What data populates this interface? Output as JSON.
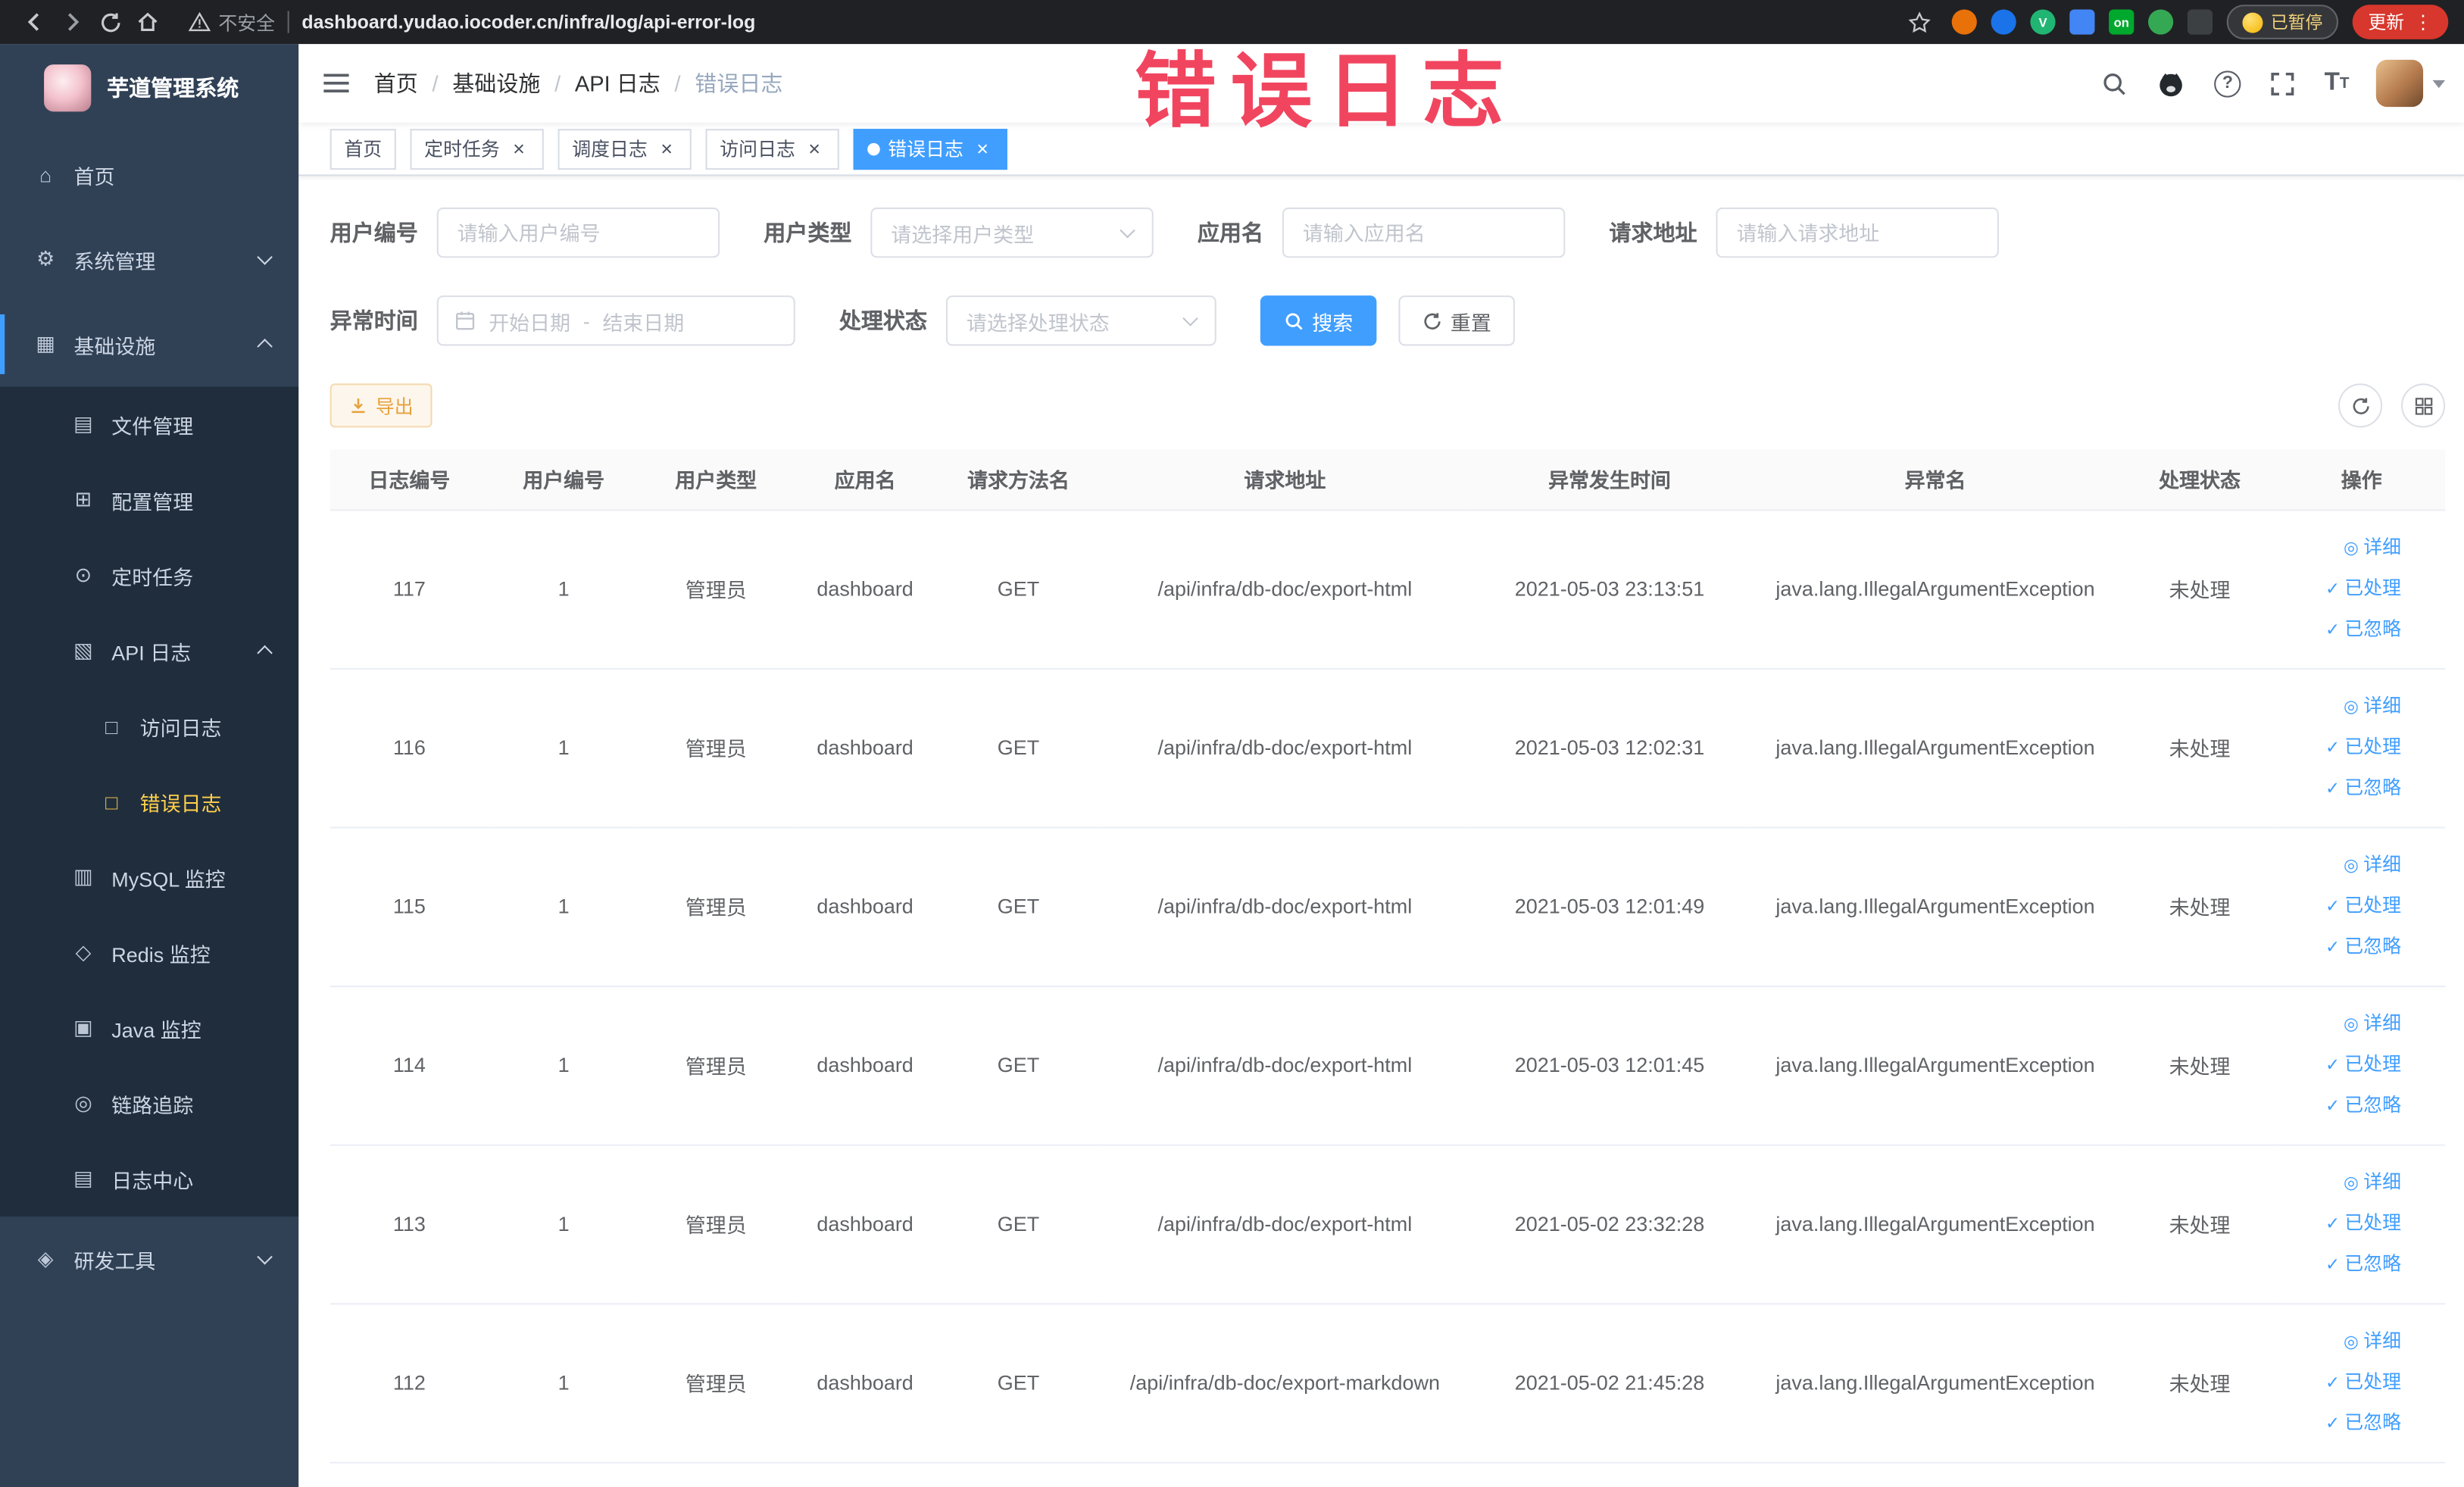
{
  "browser": {
    "security_label": "不安全",
    "url": "dashboard.yudao.iocoder.cn/infra/log/api-error-log",
    "paused_badge": "已暂停",
    "update_label": "更新",
    "extensions": [
      {
        "key": "orange",
        "icon": "extension-orange-icon",
        "color": "#e8710a",
        "shape": "circle",
        "text": ""
      },
      {
        "key": "blue-drop",
        "icon": "extension-blue-icon",
        "color": "#1a73e8",
        "shape": "circle",
        "text": ""
      },
      {
        "key": "green-v",
        "icon": "extension-green-v-icon",
        "color": "#21b573",
        "shape": "circle",
        "text": "V"
      },
      {
        "key": "blue-grid",
        "icon": "extension-grid-icon",
        "color": "#4285f4",
        "shape": "square",
        "text": ""
      },
      {
        "key": "on-badge",
        "icon": "extension-on-badge-icon",
        "color": "#00a82d",
        "shape": "square",
        "text": "on"
      },
      {
        "key": "green-leaf",
        "icon": "extension-leaf-icon",
        "color": "#34a853",
        "shape": "circle",
        "text": ""
      },
      {
        "key": "dark-pin",
        "icon": "extension-pin-icon",
        "color": "#3c4043",
        "shape": "square",
        "text": ""
      }
    ]
  },
  "watermark": "错误日志",
  "colors": {
    "accent": "#409eff",
    "sidebar_bg": "#304156",
    "active_menu_text": "#ffd04b",
    "watermark": "#f1455f",
    "warning": "#e6a23c"
  },
  "sidebar": {
    "logo_title": "芋道管理系统",
    "items": [
      {
        "key": "home",
        "label": "首页",
        "icon": "home-icon",
        "glyph": "⌂",
        "level": 1
      },
      {
        "key": "system",
        "label": "系统管理",
        "icon": "gear-icon",
        "glyph": "⚙",
        "level": 1,
        "arrow": "down"
      },
      {
        "key": "infra",
        "label": "基础设施",
        "icon": "infra-icon",
        "glyph": "▦",
        "level": 1,
        "arrow": "up",
        "open": true
      },
      {
        "key": "file",
        "label": "文件管理",
        "icon": "folder-icon",
        "glyph": "▤",
        "level": 2
      },
      {
        "key": "config",
        "label": "配置管理",
        "icon": "config-icon",
        "glyph": "⊞",
        "level": 2
      },
      {
        "key": "job",
        "label": "定时任务",
        "icon": "timer-icon",
        "glyph": "⊙",
        "level": 2
      },
      {
        "key": "api-log",
        "label": "API 日志",
        "icon": "api-log-icon",
        "glyph": "▧",
        "level": 2,
        "arrow": "up"
      },
      {
        "key": "access-log",
        "label": "访问日志",
        "icon": "access-log-icon",
        "glyph": "□",
        "level": 3
      },
      {
        "key": "error-log",
        "label": "错误日志",
        "icon": "error-log-icon",
        "glyph": "□",
        "level": 3,
        "active": true
      },
      {
        "key": "mysql",
        "label": "MySQL 监控",
        "icon": "mysql-icon",
        "glyph": "▥",
        "level": 2
      },
      {
        "key": "redis",
        "label": "Redis 监控",
        "icon": "redis-icon",
        "glyph": "◇",
        "level": 2
      },
      {
        "key": "java",
        "label": "Java 监控",
        "icon": "java-icon",
        "glyph": "▣",
        "level": 2
      },
      {
        "key": "trace",
        "label": "链路追踪",
        "icon": "trace-icon",
        "glyph": "◎",
        "level": 2
      },
      {
        "key": "log-center",
        "label": "日志中心",
        "icon": "log-center-icon",
        "glyph": "▤",
        "level": 2
      },
      {
        "key": "devtools",
        "label": "研发工具",
        "icon": "tools-icon",
        "glyph": "◈",
        "level": 1,
        "arrow": "down"
      }
    ]
  },
  "breadcrumb": {
    "items": [
      "首页",
      "基础设施",
      "API 日志",
      "错误日志"
    ],
    "separator": "/"
  },
  "tags": [
    {
      "label": "首页",
      "closable": false,
      "active": false
    },
    {
      "label": "定时任务",
      "closable": true,
      "active": false
    },
    {
      "label": "调度日志",
      "closable": true,
      "active": false
    },
    {
      "label": "访问日志",
      "closable": true,
      "active": false
    },
    {
      "label": "错误日志",
      "closable": true,
      "active": true
    }
  ],
  "filters": {
    "user_id": {
      "label": "用户编号",
      "placeholder": "请输入用户编号"
    },
    "user_type": {
      "label": "用户类型",
      "placeholder": "请选择用户类型"
    },
    "app_name": {
      "label": "应用名",
      "placeholder": "请输入应用名"
    },
    "request_url": {
      "label": "请求地址",
      "placeholder": "请输入请求地址"
    },
    "exception_time": {
      "label": "异常时间",
      "start_placeholder": "开始日期",
      "separator": "-",
      "end_placeholder": "结束日期"
    },
    "process_status": {
      "label": "处理状态",
      "placeholder": "请选择处理状态"
    },
    "search_label": "搜索",
    "reset_label": "重置"
  },
  "toolbar": {
    "export_label": "导出"
  },
  "table": {
    "columns": [
      "日志编号",
      "用户编号",
      "用户类型",
      "应用名",
      "请求方法名",
      "请求地址",
      "异常发生时间",
      "异常名",
      "处理状态",
      "操作"
    ],
    "actions": [
      {
        "key": "detail",
        "label": "详细",
        "icon": "eye-icon",
        "glyph": "◎"
      },
      {
        "key": "processed",
        "label": "已处理",
        "icon": "check-icon",
        "glyph": "✓"
      },
      {
        "key": "ignored",
        "label": "已忽略",
        "icon": "check-icon",
        "glyph": "✓"
      }
    ],
    "rows": [
      {
        "id": "117",
        "user_id": "1",
        "user_type": "管理员",
        "app": "dashboard",
        "method": "GET",
        "url": "/api/infra/db-doc/export-html",
        "time": "2021-05-03 23:13:51",
        "exception": "java.lang.IllegalArgumentException",
        "status": "未处理"
      },
      {
        "id": "116",
        "user_id": "1",
        "user_type": "管理员",
        "app": "dashboard",
        "method": "GET",
        "url": "/api/infra/db-doc/export-html",
        "time": "2021-05-03 12:02:31",
        "exception": "java.lang.IllegalArgumentException",
        "status": "未处理"
      },
      {
        "id": "115",
        "user_id": "1",
        "user_type": "管理员",
        "app": "dashboard",
        "method": "GET",
        "url": "/api/infra/db-doc/export-html",
        "time": "2021-05-03 12:01:49",
        "exception": "java.lang.IllegalArgumentException",
        "status": "未处理"
      },
      {
        "id": "114",
        "user_id": "1",
        "user_type": "管理员",
        "app": "dashboard",
        "method": "GET",
        "url": "/api/infra/db-doc/export-html",
        "time": "2021-05-03 12:01:45",
        "exception": "java.lang.IllegalArgumentException",
        "status": "未处理"
      },
      {
        "id": "113",
        "user_id": "1",
        "user_type": "管理员",
        "app": "dashboard",
        "method": "GET",
        "url": "/api/infra/db-doc/export-html",
        "time": "2021-05-02 23:32:28",
        "exception": "java.lang.IllegalArgumentException",
        "status": "未处理"
      },
      {
        "id": "112",
        "user_id": "1",
        "user_type": "管理员",
        "app": "dashboard",
        "method": "GET",
        "url": "/api/infra/db-doc/export-markdown",
        "time": "2021-05-02 21:45:28",
        "exception": "java.lang.IllegalArgumentException",
        "status": "未处理"
      }
    ]
  }
}
